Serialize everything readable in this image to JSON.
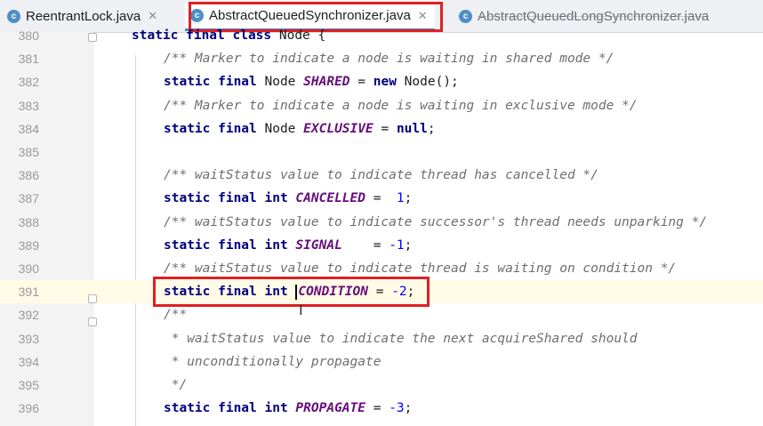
{
  "tabs": [
    {
      "label": "ReentrantLock.java",
      "icon": "class-icon",
      "active": false
    },
    {
      "label": "AbstractQueuedSynchronizer.java",
      "icon": "class-icon",
      "active": true
    },
    {
      "label": "AbstractQueuedLongSynchronizer.java",
      "icon": "class-icon",
      "active": false
    }
  ],
  "editor": {
    "caret_line": "391",
    "lines": [
      {
        "num": "380",
        "tokens": [
          [
            "kw",
            "static final class"
          ],
          [
            "",
            " Node {"
          ]
        ]
      },
      {
        "num": "381",
        "tokens": [
          [
            "cm",
            "/** Marker to indicate a node is waiting in shared mode */"
          ]
        ]
      },
      {
        "num": "382",
        "tokens": [
          [
            "kw",
            "static final"
          ],
          [
            "",
            " Node "
          ],
          [
            "cf",
            "SHARED"
          ],
          [
            "",
            " = "
          ],
          [
            "kw",
            "new"
          ],
          [
            "",
            " Node();"
          ]
        ]
      },
      {
        "num": "383",
        "tokens": [
          [
            "cm",
            "/** Marker to indicate a node is waiting in exclusive mode */"
          ]
        ]
      },
      {
        "num": "384",
        "tokens": [
          [
            "kw",
            "static final"
          ],
          [
            "",
            " Node "
          ],
          [
            "cf",
            "EXCLUSIVE"
          ],
          [
            "",
            " = "
          ],
          [
            "kw",
            "null"
          ],
          [
            "",
            ";"
          ]
        ]
      },
      {
        "num": "385",
        "tokens": []
      },
      {
        "num": "386",
        "tokens": [
          [
            "cm",
            "/** waitStatus value to indicate thread has cancelled */"
          ]
        ]
      },
      {
        "num": "387",
        "tokens": [
          [
            "kw",
            "static final int"
          ],
          [
            "",
            " "
          ],
          [
            "cf",
            "CANCELLED"
          ],
          [
            "",
            " =  "
          ],
          [
            "num",
            "1"
          ],
          [
            "",
            ";"
          ]
        ]
      },
      {
        "num": "388",
        "tokens": [
          [
            "cm",
            "/** waitStatus value to indicate successor's thread needs unparking */"
          ]
        ]
      },
      {
        "num": "389",
        "tokens": [
          [
            "kw",
            "static final int"
          ],
          [
            "",
            " "
          ],
          [
            "cf",
            "SIGNAL"
          ],
          [
            "",
            "    = "
          ],
          [
            "num",
            "-1"
          ],
          [
            "",
            ";"
          ]
        ]
      },
      {
        "num": "390",
        "tokens": [
          [
            "cm",
            "/** waitStatus value to indicate thread is waiting on condition */"
          ]
        ]
      },
      {
        "num": "391",
        "tokens": [
          [
            "kw",
            "static final int"
          ],
          [
            "",
            " "
          ],
          [
            "caret",
            ""
          ],
          [
            "cf",
            "CONDITION"
          ],
          [
            "",
            " = "
          ],
          [
            "num",
            "-2"
          ],
          [
            "",
            ";"
          ]
        ]
      },
      {
        "num": "392",
        "tokens": [
          [
            "cm",
            "/**"
          ]
        ]
      },
      {
        "num": "393",
        "tokens": [
          [
            "cm",
            " * waitStatus value to indicate the next acquireShared should"
          ]
        ]
      },
      {
        "num": "394",
        "tokens": [
          [
            "cm",
            " * unconditionally propagate"
          ]
        ]
      },
      {
        "num": "395",
        "tokens": [
          [
            "cm",
            " */"
          ]
        ]
      },
      {
        "num": "396",
        "tokens": [
          [
            "kw",
            "static final int"
          ],
          [
            "",
            " "
          ],
          [
            "cf",
            "PROPAGATE"
          ],
          [
            "",
            " = "
          ],
          [
            "num",
            "-3"
          ],
          [
            "",
            ";"
          ]
        ]
      }
    ]
  },
  "colors": {
    "keyword": "#000080",
    "comment": "#6e6e6e",
    "constant": "#660e7a",
    "number": "#0000ff",
    "highlight_box": "#e02020"
  }
}
